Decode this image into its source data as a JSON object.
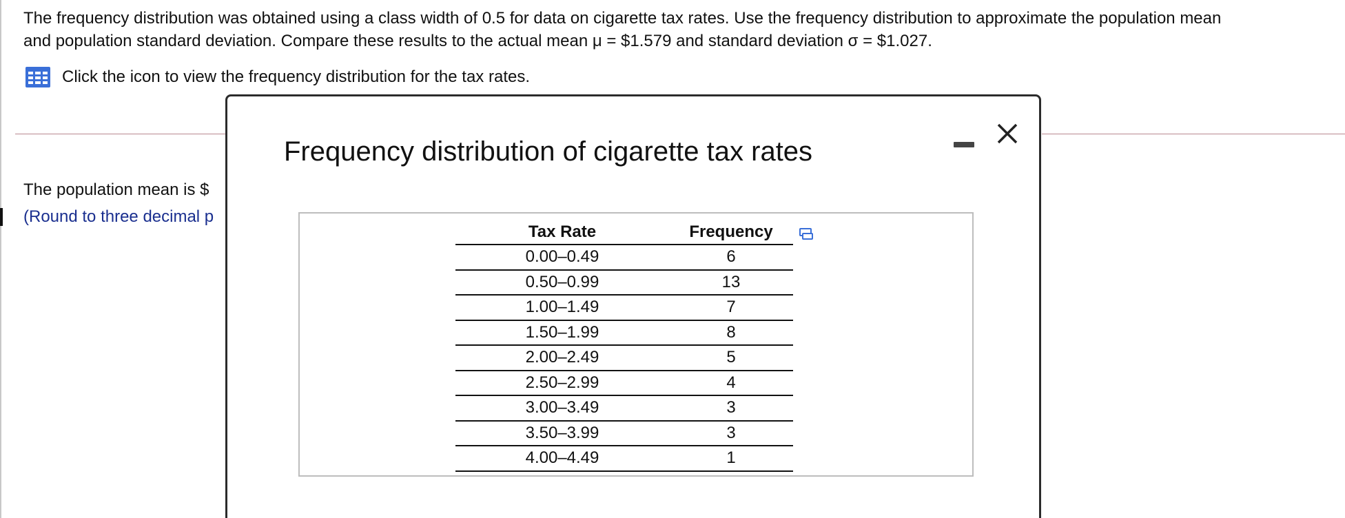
{
  "question": {
    "line1": "The frequency distribution was obtained using a class width of 0.5 for data on cigarette tax rates. Use the frequency distribution to approximate the population mean",
    "line2": "and population standard deviation. Compare these results to the actual mean μ = $1.579 and standard deviation σ = $1.027."
  },
  "icon_prompt": {
    "icon": "table-grid-icon",
    "text": "Click the icon to view the frequency distribution for the tax rates."
  },
  "answer": {
    "mean_text": "The population mean is $",
    "hint_text": "(Round to three decimal p"
  },
  "dialog": {
    "title": "Frequency distribution of cigarette tax rates",
    "minimize_icon": "minimize-icon",
    "close_icon": "close-icon",
    "copy_icon": "copy-icon",
    "table": {
      "headers": [
        "Tax Rate",
        "Frequency"
      ],
      "rows": [
        [
          "0.00–0.49",
          "6"
        ],
        [
          "0.50–0.99",
          "13"
        ],
        [
          "1.00–1.49",
          "7"
        ],
        [
          "1.50–1.99",
          "8"
        ],
        [
          "2.00–2.49",
          "5"
        ],
        [
          "2.50–2.99",
          "4"
        ],
        [
          "3.00–3.49",
          "3"
        ],
        [
          "3.50–3.99",
          "3"
        ],
        [
          "4.00–4.49",
          "1"
        ]
      ]
    }
  },
  "colors": {
    "link_blue": "#1a2f8f",
    "icon_blue": "#3a6fd8",
    "divider": "#b8888e",
    "dialog_border": "#2b2b2b"
  }
}
